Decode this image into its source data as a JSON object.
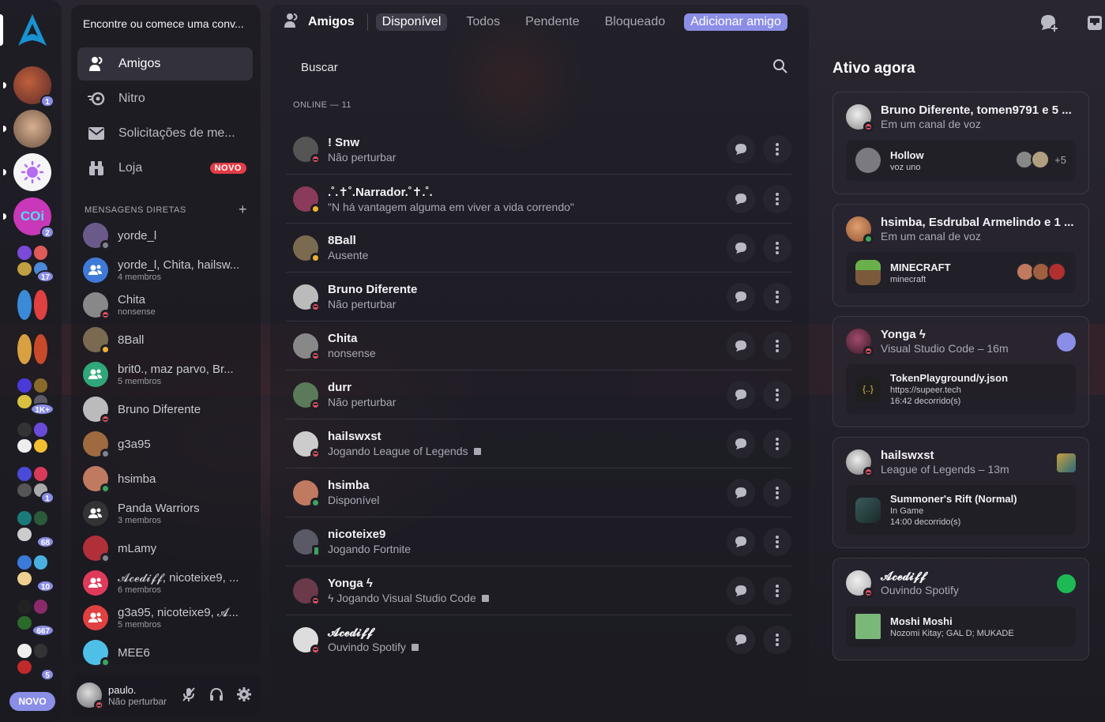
{
  "colors": {
    "accent": "#8b8ee6",
    "dnd": "#e8525d",
    "online": "#3ba55c",
    "idle": "#f0b232",
    "offline": "#80848e",
    "badge_red": "#e23c46",
    "spotify_green": "#1db954"
  },
  "rail": {
    "home_icon": "arch-linux-logo-icon",
    "badges": [
      "1",
      "2",
      "17",
      "1K+",
      "1",
      "68",
      "10",
      "667",
      "5"
    ],
    "server_label": "COi",
    "novo": "NOVO"
  },
  "dm": {
    "search_placeholder": "Encontre ou comece uma conv...",
    "nav": [
      {
        "label": "Amigos",
        "icon": "friends-icon"
      },
      {
        "label": "Nitro",
        "icon": "nitro-icon"
      },
      {
        "label": "Solicitações de me...",
        "icon": "envelope-icon"
      },
      {
        "label": "Loja",
        "icon": "store-icon",
        "tag": "NOVO"
      }
    ],
    "header": "MENSAGENS DIRETAS",
    "items": [
      {
        "name": "yorde_l",
        "sub": "",
        "status": "offline",
        "color": "#6a5a8a"
      },
      {
        "name": "yorde_l, Chita, hailsw...",
        "sub": "4 membros",
        "group": true,
        "color": "#3f7ad8"
      },
      {
        "name": "Chita",
        "sub": "nonsense",
        "status": "dnd",
        "color": "#888"
      },
      {
        "name": "8Ball",
        "sub": "",
        "status": "idle",
        "color": "#7a6a50"
      },
      {
        "name": "brit0., maz parvo, Br...",
        "sub": "5 membros",
        "group": true,
        "color": "#2fa77a"
      },
      {
        "name": "Bruno Diferente",
        "sub": "",
        "status": "dnd",
        "color": "#bbb"
      },
      {
        "name": "g3a95",
        "sub": "",
        "status": "offline",
        "color": "#a06a40"
      },
      {
        "name": "hsimba",
        "sub": "",
        "status": "online",
        "color": "#c07a60"
      },
      {
        "name": "Panda Warriors",
        "sub": "3 membros",
        "group": true,
        "color": "#333"
      },
      {
        "name": "mLamy",
        "sub": "",
        "status": "offline",
        "color": "#b0303a"
      },
      {
        "name": "𝓐𝓬𝓮𝓭𝓲𝓯𝓯, nicoteixe9, ...",
        "sub": "6 membros",
        "group": true,
        "color": "#e03a5a"
      },
      {
        "name": "g3a95, nicoteixe9, 𝓐...",
        "sub": "5 membros",
        "group": true,
        "color": "#e04040"
      },
      {
        "name": "MEE6",
        "sub": "",
        "status": "online",
        "color": "#4ec0e8"
      }
    ]
  },
  "user": {
    "name": "paulo.",
    "status": "Não perturbar",
    "icons": [
      "mute-mic-icon",
      "headphones-icon",
      "settings-gear-icon"
    ]
  },
  "topbar": {
    "title": "Amigos",
    "tabs": [
      "Disponível",
      "Todos",
      "Pendente",
      "Bloqueado"
    ],
    "add_friend": "Adicionar amigo",
    "right_icons": [
      "new-group-dm-icon",
      "inbox-icon"
    ]
  },
  "main": {
    "search_placeholder": "Buscar",
    "online_header": "ONLINE — 11",
    "friends": [
      {
        "name": "! Snw",
        "sub": "Não perturbar",
        "status": "dnd",
        "color": "#555"
      },
      {
        "name": ".˚.✝︎˚.Narrador.˚✝︎.˚.",
        "sub": "\"N há vantagem alguma em viver a vida correndo\"",
        "status": "idle",
        "color": "#8a3a5a"
      },
      {
        "name": "8Ball",
        "sub": "Ausente",
        "status": "idle",
        "color": "#7a6a50"
      },
      {
        "name": "Bruno Diferente",
        "sub": "Não perturbar",
        "status": "dnd",
        "color": "#bbb"
      },
      {
        "name": "Chita",
        "sub": "nonsense",
        "status": "dnd",
        "color": "#888"
      },
      {
        "name": "durr",
        "sub": "Não perturbar",
        "status": "dnd",
        "color": "#5a7a5a"
      },
      {
        "name": "hailswxst",
        "sub": "Jogando League of Legends",
        "status": "dnd",
        "color": "#ccc",
        "doc": true
      },
      {
        "name": "hsimba",
        "sub": "Disponível",
        "status": "online",
        "color": "#c07a60"
      },
      {
        "name": "nicoteixe9",
        "sub": "Jogando Fortnite",
        "status": "mobile",
        "color": "#5a5a66"
      },
      {
        "name": "Yonga ϟ",
        "sub": "ϟ Jogando Visual Studio Code",
        "status": "dnd",
        "color": "#6a3a4a",
        "doc": true
      },
      {
        "name": "𝓐𝓬𝓮𝓭𝓲𝓯𝓯",
        "sub": "Ouvindo Spotify",
        "status": "dnd",
        "color": "#ddd",
        "doc": true
      }
    ],
    "row_icons": [
      "message-icon",
      "more-vertical-icon"
    ]
  },
  "active_now": {
    "title": "Ativo agora",
    "cards": [
      {
        "title": "Bruno Diferente, tomen9791 e 5 ...",
        "sub": "Em um canal de voz",
        "inner_title": "Hollow",
        "inner_line1": "voz uno",
        "inner_line2": "",
        "extra": "+5"
      },
      {
        "title": "hsimba, Esdrubal Armelindo e 1 ...",
        "sub": "Em um canal de voz",
        "inner_title": "MINECRAFT",
        "inner_line1": "minecraft",
        "inner_line2": ""
      },
      {
        "title": "Yonga ϟ",
        "sub": "Visual Studio Code – 16m",
        "inner_title": "TokenPlayground/y.json",
        "inner_line1": "https://supeer.tech",
        "inner_line2": "16:42 decorrido(s)",
        "icon_glyph": "{..}"
      },
      {
        "title": "hailswxst",
        "sub": "League of Legends – 13m",
        "inner_title": "Summoner's Rift (Normal)",
        "inner_line1": "In Game",
        "inner_line2": "14:00 decorrido(s)"
      },
      {
        "title": "𝓐𝓬𝓮𝓭𝓲𝓯𝓯",
        "sub": "Ouvindo Spotify",
        "inner_title": "Moshi Moshi",
        "inner_line1": "Nozomi Kitay; GAL D; MUKADE",
        "inner_line2": ""
      }
    ]
  }
}
